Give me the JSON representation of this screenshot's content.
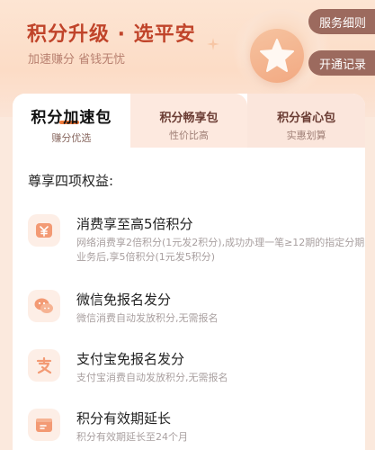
{
  "hero": {
    "title": "积分升级 · 选平安",
    "subtitle": "加速赚分 省钱无忧"
  },
  "side_buttons": {
    "service_detail": "服务细则",
    "subscription_record": "开通记录"
  },
  "tabs": [
    {
      "name": "积分加速包",
      "sub": "赚分优选",
      "active": true
    },
    {
      "name": "积分畅享包",
      "sub": "性价比高",
      "active": false
    },
    {
      "name": "积分省心包",
      "sub": "实惠划算",
      "active": false
    }
  ],
  "benefits_section": {
    "title": "尊享四项权益:",
    "items": [
      {
        "icon": "yuan-card-icon",
        "title": "消费享至高5倍积分",
        "desc": "网络消费享2倍积分(1元发2积分),成功办理一笔≥12期的指定分期业务后,享5倍积分(1元发5积分)"
      },
      {
        "icon": "wechat-icon",
        "title": "微信免报名发分",
        "desc": "微信消费自动发放积分,无需报名"
      },
      {
        "icon": "alipay-icon",
        "title": "支付宝免报名发分",
        "desc": "支付宝消费自动发放积分,无需报名"
      },
      {
        "icon": "calendar-card-icon",
        "title": "积分有效期延长",
        "desc": "积分有效期延长至24个月"
      }
    ]
  },
  "colors": {
    "accent": "#f07a3c",
    "title_red": "#c0442a",
    "pill_bg": "#9c6a5e"
  }
}
